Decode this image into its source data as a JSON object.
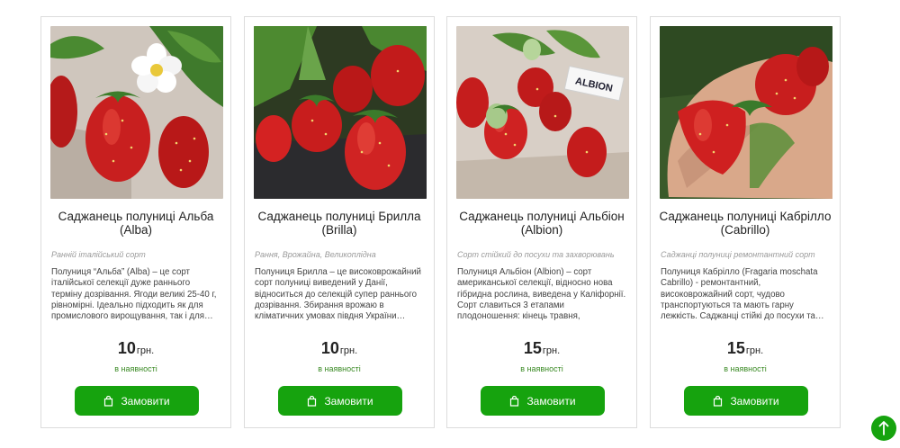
{
  "products": [
    {
      "title": "Саджанець полуниці Альба (Alba)",
      "subtitle": "Ранній італійський сорт",
      "description": "Полуниця “Альба” (Alba) – це сорт італійської селекції дуже раннього терміну дозрівання. Ягоди великі 25-40 г, рівномірні. Ідеально підходить як для промислового вирощування, так і для…",
      "price": "10",
      "currency": "грн.",
      "stock": "в наявності",
      "button_label": "Замовити",
      "image_icon": "strawberry-with-flower-photo"
    },
    {
      "title": "Саджанець полуниці Брилла (Brilla)",
      "subtitle": "Рання, Врожайна, Великоплідна",
      "description": "Полуниця Брилла – це високоврожайний сорт полуниці виведений у Данії, відноситься до селекцій супер раннього дозрівання. Збирання врожаю в кліматичних умовах півдня України…",
      "price": "10",
      "currency": "грн.",
      "stock": "в наявності",
      "button_label": "Замовити",
      "image_icon": "strawberries-on-mulch-photo"
    },
    {
      "title": "Саджанець полуниці Альбіон (Albion)",
      "subtitle": "Сорт стійкий до посухи та захворювань",
      "description": "Полуниця Альбіон (Albion) – сорт американської селекції, відносно нова гібридна рослина, виведена у Каліфорнії. Сорт славиться 3 етапами плодоношення: кінець травня, середина…",
      "price": "15",
      "currency": "грн.",
      "stock": "в наявності",
      "button_label": "Замовити",
      "image_icon": "strawberries-with-albion-label-photo",
      "image_label": "ALBION"
    },
    {
      "title": "Саджанець полуниці Кабрілло (Cabrillo)",
      "subtitle": "Саджанці полуниці ремонтантний сорт",
      "description": "Полуниця Кабрілло (Fragaria moschata Cabrillo) - ремонтантний, високоврожайний сорт, чудово транспортуються та мають гарну лежкість. Саджанці стійкі до посухи та…",
      "price": "15",
      "currency": "грн.",
      "stock": "в наявності",
      "button_label": "Замовити",
      "image_icon": "strawberries-in-hand-photo"
    }
  ],
  "colors": {
    "accent": "#16a30e",
    "stock_text": "#3a8a24",
    "card_border": "#dcdcdc"
  },
  "scroll_top_icon": "arrow-up-icon"
}
